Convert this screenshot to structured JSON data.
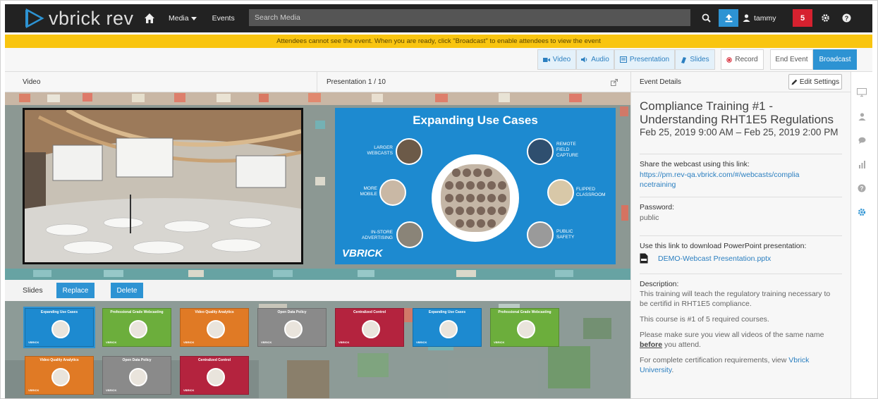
{
  "brand": {
    "name": "vbrick rev",
    "accent": "#2d93d3",
    "banner_color": "#f9c510"
  },
  "nav": {
    "media_label": "Media",
    "events_label": "Events",
    "search_placeholder": "Search Media",
    "user_name": "tammy",
    "notification_count": "5"
  },
  "banner": {
    "text": "Attendees cannot see the event. When you are ready, click \"Broadcast\" to enable attendees to view the event"
  },
  "toolbar": {
    "video": "Video",
    "audio": "Audio",
    "presentation": "Presentation",
    "slides": "Slides",
    "record": "Record",
    "end_event": "End Event",
    "broadcast": "Broadcast"
  },
  "panels": {
    "video_header": "Video",
    "presentation_header": "Presentation 1 / 10",
    "details_header": "Event Details",
    "edit_settings": "Edit Settings"
  },
  "slide": {
    "title": "Expanding Use Cases",
    "labels": [
      "LARGER WEBCASTS",
      "MORE MOBILE",
      "IN-STORE ADVERTISING",
      "REMOTE FIELD CAPTURE",
      "FLIPPED CLASSROOM",
      "PUBLIC SAFETY"
    ],
    "brand": "VBRICK"
  },
  "slides_bar": {
    "label": "Slides",
    "replace": "Replace",
    "delete": "Delete"
  },
  "thumbnails": [
    {
      "title": "Expanding Use Cases",
      "color": "#1d8ad0"
    },
    {
      "title": "Professional Grade Webcasting",
      "color": "#6cae3c"
    },
    {
      "title": "Video Quality Analytics",
      "color": "#e07a25"
    },
    {
      "title": "Open Data Policy",
      "color": "#8a8a8a"
    },
    {
      "title": "Centralized Control",
      "color": "#b4233e"
    },
    {
      "title": "Expanding Use Cases",
      "color": "#1d8ad0"
    },
    {
      "title": "Professional Grade Webcasting",
      "color": "#6cae3c"
    },
    {
      "title": "Video Quality Analytics",
      "color": "#e07a25"
    },
    {
      "title": "Open Data Policy",
      "color": "#8a8a8a"
    },
    {
      "title": "Centralized Control",
      "color": "#b4233e"
    }
  ],
  "event": {
    "title": "Compliance Training #1 - Understanding RHT1E5 Regulations",
    "dates": "Feb 25, 2019 9:00 AM – Feb 25, 2019 2:00 PM",
    "share_label": "Share the webcast using this link:",
    "share_link": "https://pm.rev-qa.vbrick.com/#/webcasts/compliancetraining",
    "password_label": "Password:",
    "password_value": "public",
    "download_label": "Use this link to download PowerPoint presentation:",
    "download_file": "DEMO-Webcast Presentation.pptx",
    "description_label": "Description:",
    "description_1": "This training will teach the regulatory training necessary to be certifid in RHT1E5 compliance.",
    "description_2": "This course is #1 of 5 required courses.",
    "description_3_before": "Please make sure you view all videos of the same name ",
    "description_3_bold": "before",
    "description_3_after": " you attend.",
    "description_4_before": "For complete certification requirements, view ",
    "description_4_link": "Vbrick University",
    "description_4_after": "."
  }
}
